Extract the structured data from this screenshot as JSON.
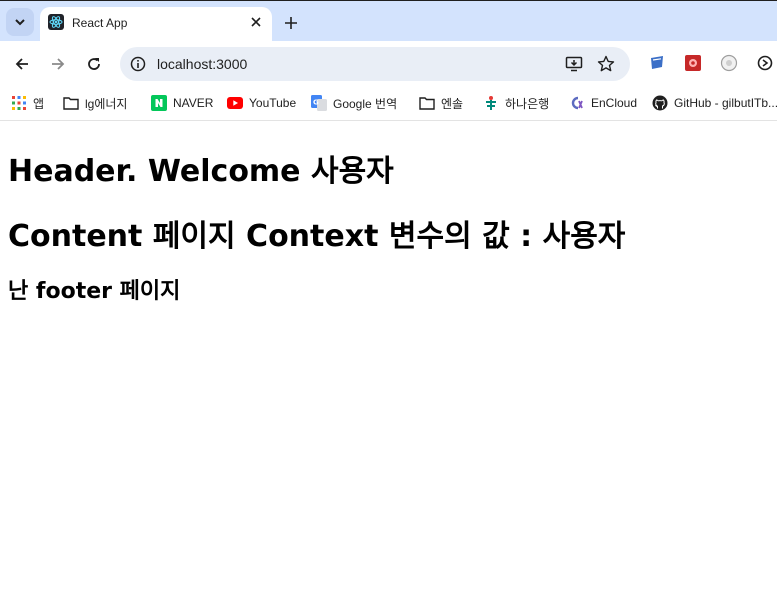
{
  "tab": {
    "title": "React App",
    "favicon": "react-logo-icon"
  },
  "toolbar": {
    "url": "localhost:3000",
    "icons": [
      "back-icon",
      "forward-icon",
      "reload-icon",
      "site-info-icon",
      "install-app-icon",
      "bookmark-star-icon"
    ]
  },
  "bookmarks": [
    {
      "label": "앱",
      "icon": "apps-grid-icon"
    },
    {
      "label": "lg에너지",
      "icon": "folder-icon"
    },
    {
      "label": "NAVER",
      "icon": "naver-icon"
    },
    {
      "label": "YouTube",
      "icon": "youtube-icon"
    },
    {
      "label": "Google 번역",
      "icon": "google-translate-icon"
    },
    {
      "label": "엔솔",
      "icon": "folder-icon"
    },
    {
      "label": "하나은행",
      "icon": "hana-bank-icon"
    },
    {
      "label": "EnCloud",
      "icon": "encloud-icon"
    },
    {
      "label": "GitHub - gilbutITb...",
      "icon": "github-icon"
    }
  ],
  "page": {
    "header": "Header. Welcome 사용자",
    "content": "Content 페이지 Context 변수의 값 : 사용자",
    "footer": "난 footer 페이지"
  },
  "colors": {
    "tabstrip": "#d3e3fd",
    "omnibox": "#e9eef6",
    "text": "#1f1f1f"
  }
}
